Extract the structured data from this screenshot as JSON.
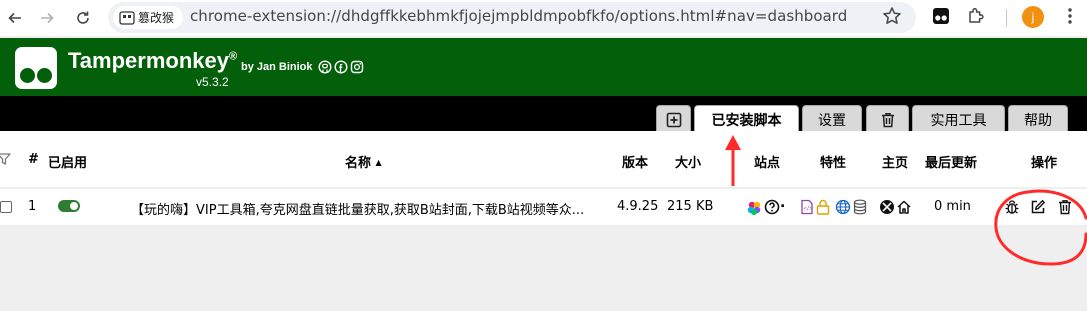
{
  "browser": {
    "site_chip_label": "篡改猴",
    "url": "chrome-extension://dhdgffkkebhmkfjojejmpbldmpobfkfo/options.html#nav=dashboard",
    "avatar_letter": "j"
  },
  "header": {
    "app_name": "Tampermonkey",
    "registered": "®",
    "byline": "by Jan Biniok",
    "version": "v5.3.2"
  },
  "tabs": [
    {
      "label": "",
      "icon": "plus-square-icon"
    },
    {
      "label": "已安装脚本",
      "active": true
    },
    {
      "label": "设置"
    },
    {
      "label": "",
      "icon": "trash-icon"
    },
    {
      "label": "实用工具"
    },
    {
      "label": "帮助"
    }
  ],
  "table": {
    "columns": {
      "num": "#",
      "enabled": "已启用",
      "name": "名称",
      "sort_indicator": "▲",
      "version": "版本",
      "size": "大小",
      "sites": "站点",
      "features": "特性",
      "homepage": "主页",
      "last_updated": "最后更新",
      "actions": "操作"
    },
    "rows": [
      {
        "index": "1",
        "enabled": true,
        "name": "【玩的嗨】VIP工具箱,夸克网盘直链批量获取,获取B站封面,下载B站视频等众...",
        "version": "4.9.25",
        "size": "215 KB",
        "last_updated": "0 min"
      }
    ]
  },
  "colors": {
    "header_green": "#045f0b",
    "tabbar_black": "#000000",
    "annotation_red": "#ff2a2a",
    "toggle_green": "#2e7d32"
  }
}
